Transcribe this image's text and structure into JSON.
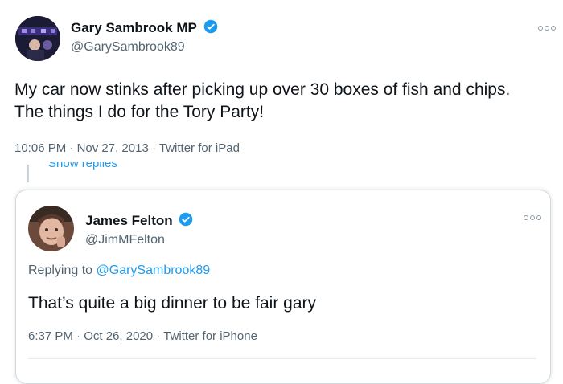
{
  "colors": {
    "accent": "#1d9bf0",
    "text": "#0f1419",
    "secondary": "#536471",
    "border": "#cfd9de"
  },
  "main_tweet": {
    "author_name": "Gary Sambrook MP",
    "handle": "@GarySambrook89",
    "text_line1": "My car now stinks after picking up over 30 boxes of fish and chips.",
    "text_line2": "The things I do for the Tory Party!",
    "time": "10:06 PM",
    "date": "Nov 27, 2013",
    "source": "Twitter for iPad",
    "sep": "·"
  },
  "show_replies_label": "Show replies",
  "reply_tweet": {
    "author_name": "James Felton",
    "handle": "@JimMFelton",
    "replying_prefix": "Replying to",
    "replying_to": "@GarySambrook89",
    "text": "That’s quite a big dinner to be fair gary",
    "time": "6:37 PM",
    "date": "Oct 26, 2020",
    "source": "Twitter for iPhone",
    "sep": "·"
  },
  "icons": {
    "verified": "verified-badge-icon",
    "more": "more-options-icon"
  }
}
